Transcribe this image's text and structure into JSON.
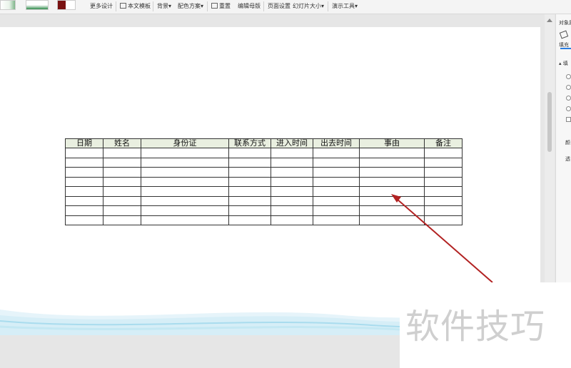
{
  "toolbar": {
    "more_design": "更多设计",
    "text_template": "本文模板",
    "background": "背景",
    "color_scheme": "配色方案",
    "reset": "重置",
    "edit_master": "编辑母版",
    "page_setup": "页面设置",
    "slide_size": "幻灯片大小",
    "present_tools": "演示工具",
    "dropdown_mark": "▾"
  },
  "table": {
    "headers": [
      "日期",
      "姓名",
      "身份证",
      "联系方式",
      "进入时间",
      "出去时间",
      "事由",
      "备注"
    ],
    "empty_rows": 8
  },
  "panel": {
    "title": "对象属",
    "fill_tab": "填充",
    "section": "▴ 填",
    "color_label": "颜",
    "transparency_label": "透"
  },
  "watermark": "软件技巧",
  "colors": {
    "header_fill": "#e9efe0",
    "arrow": "#b22222",
    "wave": "#bfe4f0"
  }
}
